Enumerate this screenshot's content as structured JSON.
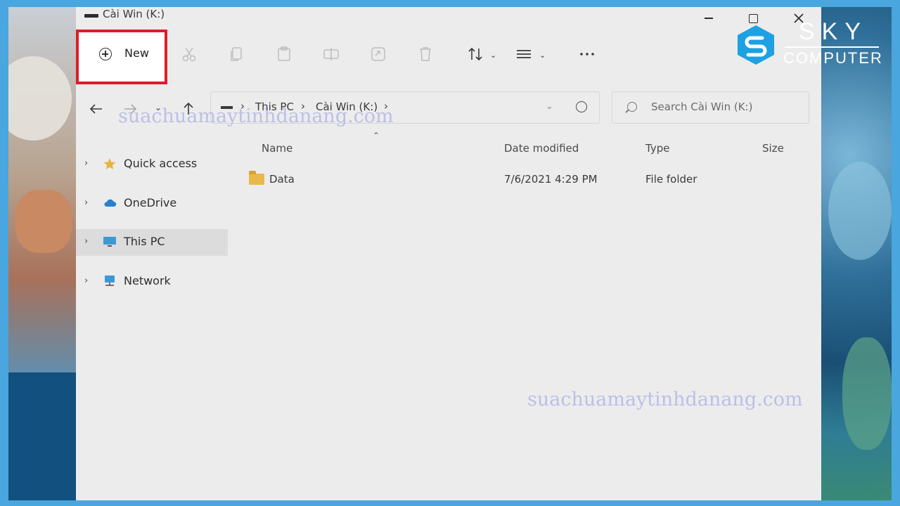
{
  "window": {
    "title": "Cài Win (K:)"
  },
  "toolbar": {
    "new_label": "New",
    "icons": [
      "cut-icon",
      "copy-icon",
      "paste-icon",
      "rename-icon",
      "share-icon",
      "delete-icon",
      "sort-icon",
      "view-icon",
      "more-icon"
    ]
  },
  "address": {
    "segments": [
      "This PC",
      "Cài Win (K:)"
    ]
  },
  "search": {
    "placeholder": "Search Cài Win (K:)"
  },
  "sidebar": {
    "items": [
      {
        "label": "Quick access"
      },
      {
        "label": "OneDrive"
      },
      {
        "label": "This PC"
      },
      {
        "label": "Network"
      }
    ]
  },
  "filelist": {
    "columns": [
      "Name",
      "Date modified",
      "Type",
      "Size"
    ],
    "rows": [
      {
        "name": "Data",
        "date": "7/6/2021 4:29 PM",
        "type": "File folder",
        "size": ""
      }
    ]
  },
  "watermarks": [
    "suachuamaytinhdanang.com",
    "suachuamaytinhdanang.com"
  ],
  "logo": {
    "line1": "SKY",
    "line2": "COMPUTER"
  },
  "colors": {
    "highlight": "#e01b2a",
    "frame": "#49a6de"
  }
}
